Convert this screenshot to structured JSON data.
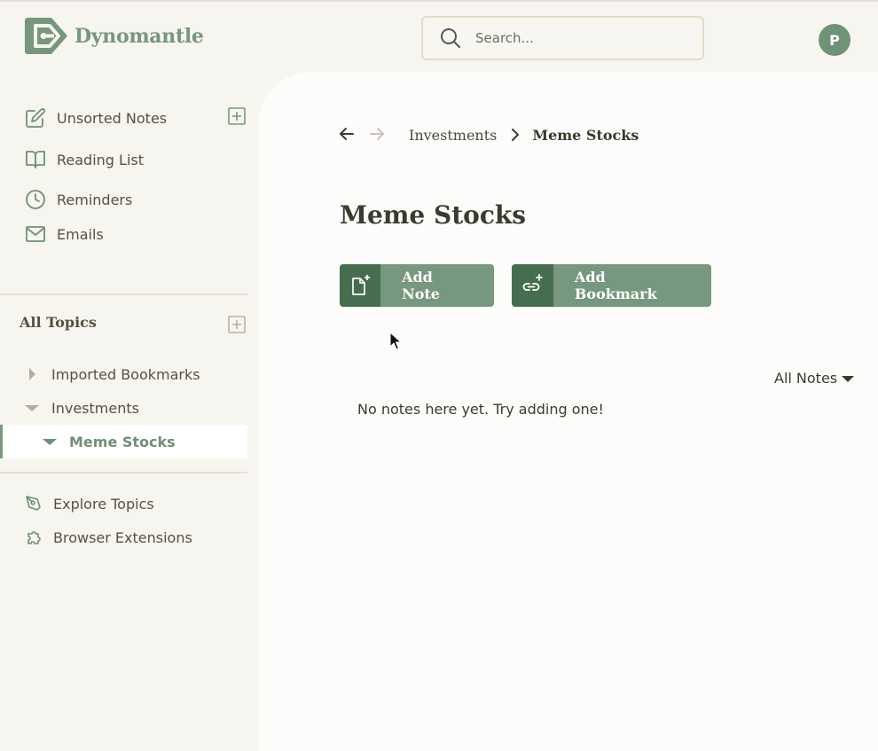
{
  "app": {
    "name": "Dynomantle"
  },
  "header": {
    "search_placeholder": "Search...",
    "avatar_initial": "P"
  },
  "sidebar": {
    "primary": [
      {
        "label": "Unsorted Notes",
        "icon": "edit-icon"
      },
      {
        "label": "Reading List",
        "icon": "book-open-icon"
      },
      {
        "label": "Reminders",
        "icon": "clock-icon"
      },
      {
        "label": "Emails",
        "icon": "mail-icon"
      }
    ],
    "topics_title": "All Topics",
    "topics": [
      {
        "label": "Imported Bookmarks",
        "state": "collapsed"
      },
      {
        "label": "Investments",
        "state": "expanded"
      },
      {
        "label": "Meme Stocks",
        "state": "expanded",
        "selected": true
      }
    ],
    "footer": [
      {
        "label": "Explore Topics",
        "icon": "pen-nib-icon"
      },
      {
        "label": "Browser Extensions",
        "icon": "puzzle-icon"
      }
    ]
  },
  "main": {
    "breadcrumb": [
      "Investments",
      "Meme Stocks"
    ],
    "title": "Meme Stocks",
    "buttons": {
      "add_note": "Add Note",
      "add_bookmark": "Add Bookmark"
    },
    "filter_label": "All Notes",
    "empty_message": "No notes here yet. Try adding one!"
  },
  "colors": {
    "brand": "#75977b",
    "button_dark": "#466e4e",
    "button_light": "#77977e"
  }
}
